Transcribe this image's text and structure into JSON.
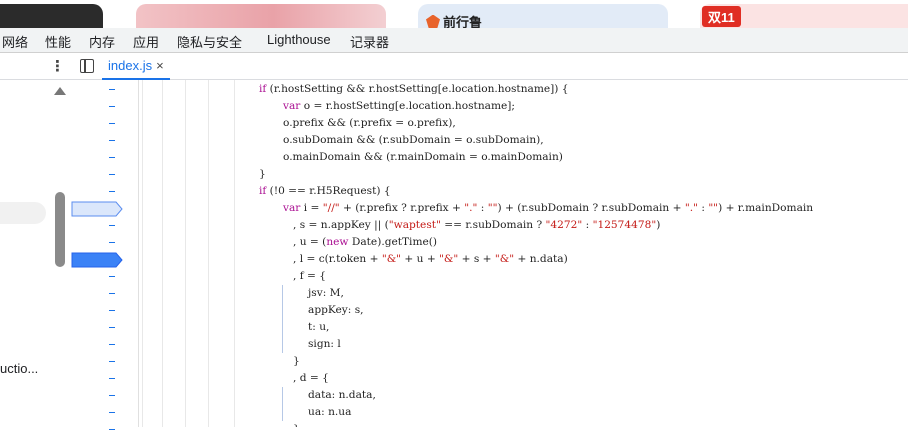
{
  "browser_tiles": {
    "brand_text": "前行鲁",
    "badge_text": "双11"
  },
  "devtools_tabs": [
    "网络",
    "性能",
    "内存",
    "应用",
    "隐私与安全",
    "Lighthouse",
    "记录器"
  ],
  "file_tab": {
    "label": "index.js",
    "close": "×"
  },
  "navigator": {
    "item_label": "uctio..."
  },
  "colors": {
    "keyword": "#aa0d91",
    "string": "#c41a16",
    "plain": "#1f1f1f",
    "accent": "#1a73e8",
    "breakpoint_active": "#3b82f6",
    "breakpoint_inactive": "#dbe7fb"
  },
  "gutter": {
    "breakpoints": [
      {
        "line_index": 7,
        "state": "inactive"
      },
      {
        "line_index": 10,
        "state": "active"
      }
    ]
  },
  "code_lines": [
    {
      "indent": 1,
      "tokens": [
        {
          "t": "if",
          "c": "k"
        },
        {
          "t": " (r.hostSetting && r.hostSetting[e.location.hostname]) {",
          "c": "p"
        }
      ]
    },
    {
      "indent": 2,
      "tokens": [
        {
          "t": "var",
          "c": "k"
        },
        {
          "t": " o = r.hostSetting[e.location.hostname];",
          "c": "p"
        }
      ]
    },
    {
      "indent": 2,
      "tokens": [
        {
          "t": "o.prefix && (r.prefix = o.prefix),",
          "c": "p"
        }
      ]
    },
    {
      "indent": 2,
      "tokens": [
        {
          "t": "o.subDomain && (r.subDomain = o.subDomain),",
          "c": "p"
        }
      ]
    },
    {
      "indent": 2,
      "tokens": [
        {
          "t": "o.mainDomain && (r.mainDomain = o.mainDomain)",
          "c": "p"
        }
      ]
    },
    {
      "indent": 1,
      "tokens": [
        {
          "t": "}",
          "c": "p"
        }
      ]
    },
    {
      "indent": 1,
      "tokens": [
        {
          "t": "if",
          "c": "k"
        },
        {
          "t": " (!0 == r.H5Request) {",
          "c": "p"
        }
      ]
    },
    {
      "indent": 2,
      "tokens": [
        {
          "t": "var",
          "c": "k"
        },
        {
          "t": " i = ",
          "c": "p"
        },
        {
          "t": "\"//\"",
          "c": "s"
        },
        {
          "t": " + (r.prefix ? r.prefix + ",
          "c": "p"
        },
        {
          "t": "\".\"",
          "c": "s"
        },
        {
          "t": " : ",
          "c": "p"
        },
        {
          "t": "\"\"",
          "c": "s"
        },
        {
          "t": ") + (r.subDomain ? r.subDomain + ",
          "c": "p"
        },
        {
          "t": "\".\"",
          "c": "s"
        },
        {
          "t": " : ",
          "c": "p"
        },
        {
          "t": "\"\"",
          "c": "s"
        },
        {
          "t": ") + r.mainDomain",
          "c": "p"
        }
      ]
    },
    {
      "indent": 3,
      "tokens": [
        {
          "t": ", s = n.appKey || (",
          "c": "p"
        },
        {
          "t": "\"waptest\"",
          "c": "s"
        },
        {
          "t": " == r.subDomain ? ",
          "c": "p"
        },
        {
          "t": "\"4272\"",
          "c": "s"
        },
        {
          "t": " : ",
          "c": "p"
        },
        {
          "t": "\"12574478\"",
          "c": "s"
        },
        {
          "t": ")",
          "c": "p"
        }
      ]
    },
    {
      "indent": 3,
      "tokens": [
        {
          "t": ", u = (",
          "c": "p"
        },
        {
          "t": "new",
          "c": "k"
        },
        {
          "t": " Date).getTime()",
          "c": "p"
        }
      ]
    },
    {
      "indent": 3,
      "tokens": [
        {
          "t": ", l = c(r.token + ",
          "c": "p"
        },
        {
          "t": "\"&\"",
          "c": "s"
        },
        {
          "t": " + u + ",
          "c": "p"
        },
        {
          "t": "\"&\"",
          "c": "s"
        },
        {
          "t": " + s + ",
          "c": "p"
        },
        {
          "t": "\"&\"",
          "c": "s"
        },
        {
          "t": " + n.data)",
          "c": "p"
        }
      ]
    },
    {
      "indent": 3,
      "tokens": [
        {
          "t": ", f = {",
          "c": "p"
        }
      ]
    },
    {
      "indent": 4,
      "tokens": [
        {
          "t": "jsv: M,",
          "c": "p"
        }
      ]
    },
    {
      "indent": 4,
      "tokens": [
        {
          "t": "appKey: s,",
          "c": "p"
        }
      ]
    },
    {
      "indent": 4,
      "tokens": [
        {
          "t": "t: u,",
          "c": "p"
        }
      ]
    },
    {
      "indent": 4,
      "tokens": [
        {
          "t": "sign: l",
          "c": "p"
        }
      ]
    },
    {
      "indent": 3,
      "tokens": [
        {
          "t": "}",
          "c": "p"
        }
      ]
    },
    {
      "indent": 3,
      "tokens": [
        {
          "t": ", d = {",
          "c": "p"
        }
      ]
    },
    {
      "indent": 4,
      "tokens": [
        {
          "t": "data: n.data,",
          "c": "p"
        }
      ]
    },
    {
      "indent": 4,
      "tokens": [
        {
          "t": "ua: n.ua",
          "c": "p"
        }
      ]
    },
    {
      "indent": 3,
      "tokens": [
        {
          "t": "};",
          "c": "p"
        }
      ]
    }
  ]
}
